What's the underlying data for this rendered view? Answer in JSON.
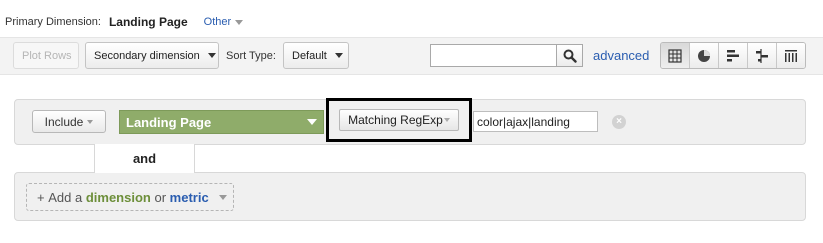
{
  "primary": {
    "label": "Primary Dimension:",
    "value": "Landing Page",
    "other": "Other"
  },
  "toolbar": {
    "plot_rows": "Plot Rows",
    "secondary_dimension": "Secondary dimension",
    "sort_type_label": "Sort Type:",
    "sort_type_value": "Default",
    "search_value": "",
    "advanced": "advanced"
  },
  "view_modes": [
    "data-table-icon",
    "pie-chart-icon",
    "performance-bar-icon",
    "comparison-icon",
    "term-cloud-icon"
  ],
  "filter": {
    "include": "Include",
    "dimension": "Landing Page",
    "match_type": "Matching RegExp",
    "value": "color|ajax|landing",
    "remove": "×"
  },
  "and_label": "and",
  "add": {
    "plus": "+",
    "prefix": "Add a",
    "dimension": "dimension",
    "or": "or",
    "metric": "metric"
  },
  "colors": {
    "dimension_green": "#8fac6a",
    "link_blue": "#2a5db0",
    "panel_gray": "#f0f0f0"
  }
}
